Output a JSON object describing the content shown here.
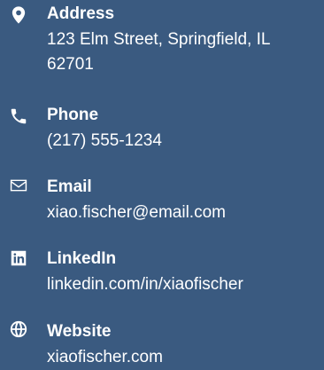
{
  "contacts": [
    {
      "icon": "location-pin-icon",
      "label": "Address",
      "value": "123 Elm Street, Springfield, IL 62701"
    },
    {
      "icon": "phone-icon",
      "label": "Phone",
      "value": "(217) 555-1234"
    },
    {
      "icon": "envelope-icon",
      "label": "Email",
      "value": "xiao.fischer@email.com"
    },
    {
      "icon": "linkedin-icon",
      "label": "LinkedIn",
      "value": "linkedin.com/in/xiaofischer"
    },
    {
      "icon": "globe-icon",
      "label": "Website",
      "value": "xiaofischer.com"
    }
  ]
}
